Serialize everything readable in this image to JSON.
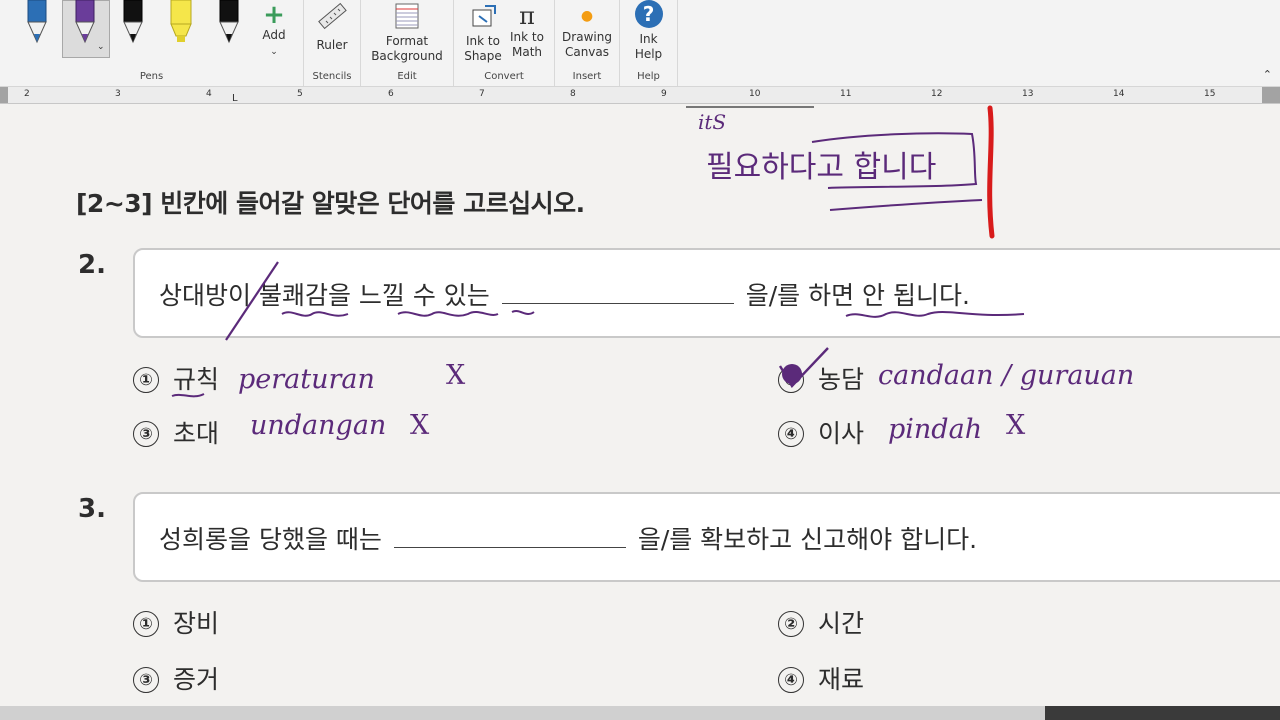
{
  "ribbon": {
    "pens_label": "Pens",
    "add_label": "Add",
    "ruler_label": "Ruler",
    "stencils_label": "Stencils",
    "format_bg_label": "Format\nBackground",
    "edit_label": "Edit",
    "ink_shape_label": "Ink to\nShape",
    "ink_math_label": "Ink to\nMath",
    "convert_label": "Convert",
    "drawing_canvas_label": "Drawing\nCanvas",
    "insert_label": "Insert",
    "ink_help_label": "Ink\nHelp",
    "help_label": "Help",
    "pen_colors": [
      "#2c6fb5",
      "#6a3d9a",
      "#111111",
      "#f5e64a",
      "#111111"
    ]
  },
  "ruler": {
    "numbers": [
      "2",
      "3",
      "4",
      "5",
      "6",
      "7",
      "8",
      "9",
      "10",
      "11",
      "12",
      "13",
      "14",
      "15"
    ]
  },
  "doc": {
    "section_title": "[2~3] 빈칸에 들어갈 알맞은 단어를 고르십시오.",
    "q2": {
      "number": "2.",
      "text_before": "상대방이 불쾌감을 느낄 수 있는",
      "text_after": "을/를 하면 안 됩니다.",
      "options": [
        {
          "num": "①",
          "text": "규칙"
        },
        {
          "num": "②",
          "text": "농담"
        },
        {
          "num": "③",
          "text": "초대"
        },
        {
          "num": "④",
          "text": "이사"
        }
      ]
    },
    "q3": {
      "number": "3.",
      "text_before": "성희롱을 당했을 때는",
      "text_after": "을/를 확보하고 신고해야 합니다.",
      "options": [
        {
          "num": "①",
          "text": "장비"
        },
        {
          "num": "②",
          "text": "시간"
        },
        {
          "num": "③",
          "text": "증거"
        },
        {
          "num": "④",
          "text": "재료"
        }
      ]
    },
    "handwriting": {
      "top_korean": "필요하다고 합니다",
      "top_small": "itS",
      "opt1": "peraturan",
      "opt2": "candaan / gurauan",
      "opt3": "undangan",
      "opt4": "pindah",
      "x_mark": "X"
    }
  }
}
